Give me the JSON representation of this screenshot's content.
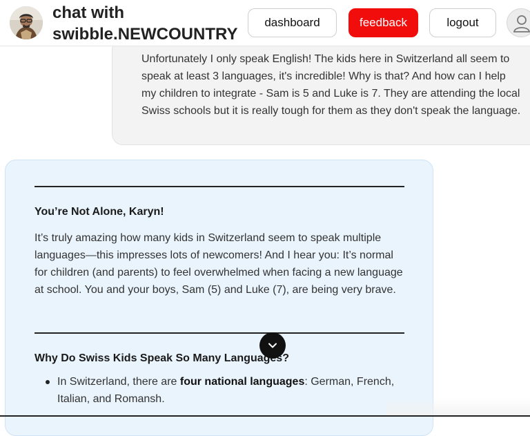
{
  "header": {
    "title_line1": "chat with",
    "title_line2": "swibble.NEWCOUNTRY",
    "nav": {
      "dashboard": "dashboard",
      "feedback": "feedback",
      "logout": "logout"
    },
    "accent_color": "#f20d0d"
  },
  "conversation": {
    "user_message": "Unfortunately I only speak English! The kids here in Switzerland all seem to speak at least 3 languages, it's incredible! Why is that? And how can I help my children to integrate - Sam is 5 and Luke is 7. They are attending the local Swiss schools but it is really tough for them as they don't speak the language.",
    "bot_message": {
      "heading1": "You’re Not Alone, Karyn!",
      "paragraph1": "It’s truly amazing how many kids in Switzerland seem to speak multiple languages—this impresses lots of newcomers! And I hear you: It’s normal for children (and parents) to feel overwhelmed when facing a new language at school. You and your boys, Sam (5) and Luke (7), are being very brave.",
      "heading2": "Why Do Swiss Kids Speak So Many Languages?",
      "bullet1_prefix": "In Switzerland, there are ",
      "bullet1_bold": "four national languages",
      "bullet1_suffix": ": German, French, Italian, and Romansh."
    }
  },
  "icons": {
    "bot_avatar": "bot-avatar-photo",
    "user_avatar": "user-icon",
    "scroll": "chevron-down-icon"
  }
}
